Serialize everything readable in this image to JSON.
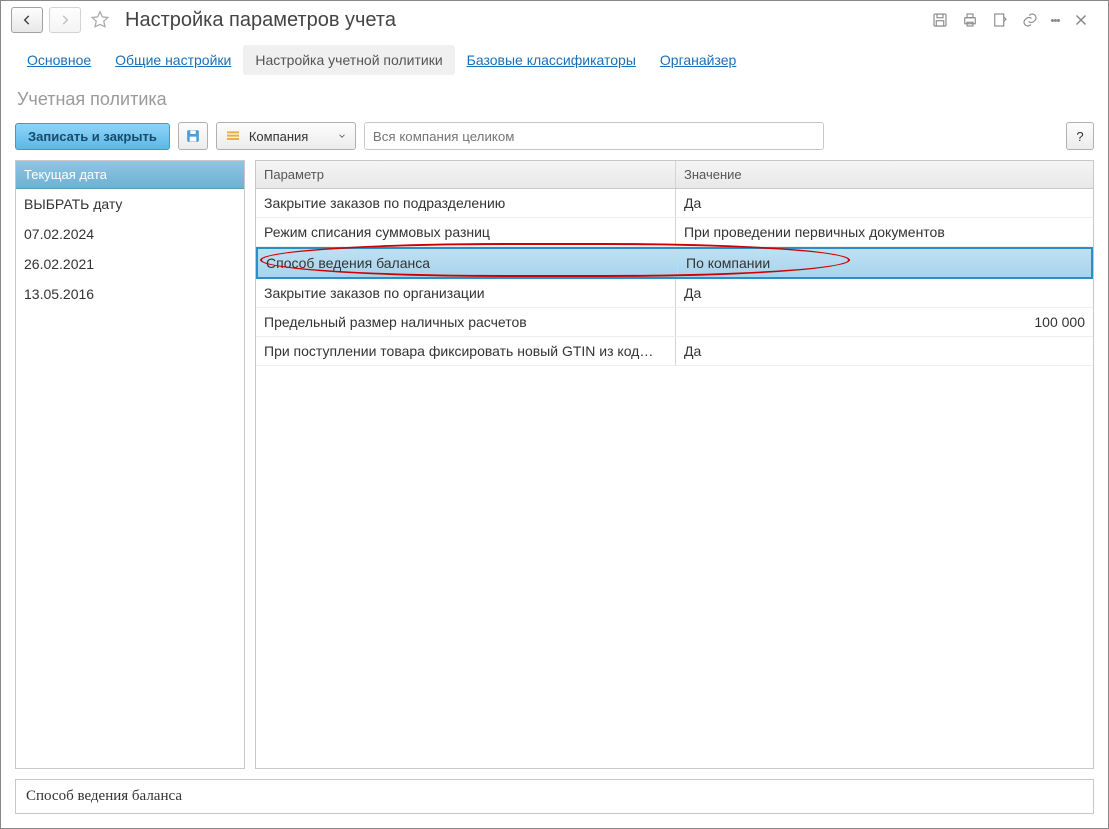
{
  "title": "Настройка параметров учета",
  "tabs": [
    "Основное",
    "Общие настройки",
    "Настройка учетной политики",
    "Базовые классификаторы",
    "Органайзер"
  ],
  "active_tab": 2,
  "subtitle": "Учетная политика",
  "toolbar": {
    "save_close": "Записать и закрыть",
    "scope_label": "Компания",
    "filter_placeholder": "Вся компания целиком",
    "help_label": "?"
  },
  "date_panel": {
    "header": "Текущая дата",
    "items": [
      "ВЫБРАТЬ дату",
      "07.02.2024",
      "26.02.2021",
      "13.05.2016"
    ]
  },
  "param_headers": {
    "param": "Параметр",
    "value": "Значение"
  },
  "params": [
    {
      "name": "Закрытие заказов по подразделению",
      "value": "Да"
    },
    {
      "name": "Режим списания суммовых разниц",
      "value": "При проведении первичных документов"
    },
    {
      "name": "Способ ведения баланса",
      "value": "По компании",
      "selected": true,
      "highlighted": true
    },
    {
      "name": "Закрытие заказов по организации",
      "value": "Да"
    },
    {
      "name": "Предельный размер наличных расчетов",
      "value": "100 000",
      "align": "right"
    },
    {
      "name": "При поступлении товара фиксировать новый GTIN из код…",
      "value": "Да"
    }
  ],
  "footer_text": "Способ ведения баланса"
}
